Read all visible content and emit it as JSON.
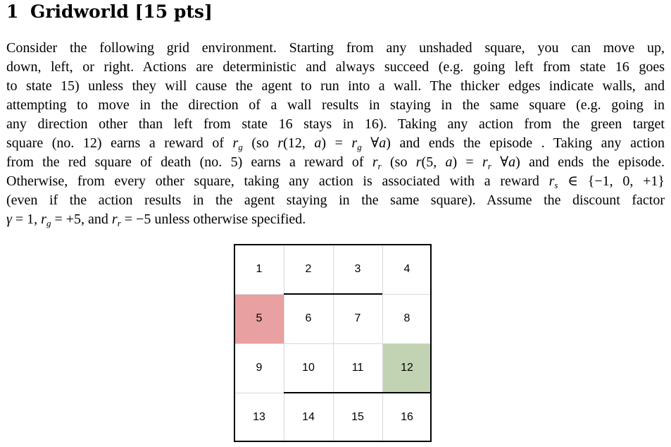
{
  "section": {
    "number": "1",
    "title": "Gridworld [15 pts]"
  },
  "paragraph_lines": [
    [
      "Consider the following grid environment. Starting from any unshaded square, you can move up,"
    ],
    [
      "down, left, or right. Actions are deterministic and always succeed (e.g. going left from state 16 goes"
    ],
    [
      "to state 15) unless they will cause the agent to run into a wall. The thicker edges indicate walls, and"
    ],
    [
      "attempting to move in the direction of a wall results in staying in the same square (e.g. going in"
    ],
    [
      "any direction other than left from state 16 stays in 16). Taking any action from the green target"
    ],
    [
      "square (no. 12) earns a reward of ",
      {
        "v": "r"
      },
      {
        "s": "g"
      },
      " (so ",
      {
        "v": "r"
      },
      "(12, ",
      {
        "v": "a"
      },
      ") = ",
      {
        "v": "r"
      },
      {
        "s": "g"
      },
      " ∀",
      {
        "v": "a"
      },
      ") and ends the episode . Taking any action"
    ],
    [
      "from the red square of death (no. 5) earns a reward of ",
      {
        "v": "r"
      },
      {
        "s": "r"
      },
      " (so ",
      {
        "v": "r"
      },
      "(5, ",
      {
        "v": "a"
      },
      ") = ",
      {
        "v": "r"
      },
      {
        "s": "r"
      },
      " ∀",
      {
        "v": "a"
      },
      ") and ends the episode."
    ],
    [
      "Otherwise, from every other square, taking any action is associated with a reward ",
      {
        "v": "r"
      },
      {
        "s": "s"
      },
      " ∈ {−1, 0, +1}"
    ],
    [
      "(even if the action results in the agent staying in the same square). Assume the discount factor"
    ],
    [
      {
        "v": "γ"
      },
      " = 1, ",
      {
        "v": "r"
      },
      {
        "s": "g"
      },
      " = +5, and ",
      {
        "v": "r"
      },
      {
        "s": "r"
      },
      " = −5 unless otherwise specified."
    ]
  ],
  "grid": {
    "cells": [
      {
        "label": "1",
        "fill": "#ffffff"
      },
      {
        "label": "2",
        "fill": "#ffffff"
      },
      {
        "label": "3",
        "fill": "#ffffff"
      },
      {
        "label": "4",
        "fill": "#ffffff"
      },
      {
        "label": "5",
        "fill": "#e8a0a0"
      },
      {
        "label": "6",
        "fill": "#ffffff"
      },
      {
        "label": "7",
        "fill": "#ffffff"
      },
      {
        "label": "8",
        "fill": "#ffffff"
      },
      {
        "label": "9",
        "fill": "#ffffff"
      },
      {
        "label": "10",
        "fill": "#ffffff"
      },
      {
        "label": "11",
        "fill": "#ffffff"
      },
      {
        "label": "12",
        "fill": "#c2d3b4"
      },
      {
        "label": "13",
        "fill": "#ffffff"
      },
      {
        "label": "14",
        "fill": "#ffffff"
      },
      {
        "label": "15",
        "fill": "#ffffff"
      },
      {
        "label": "16",
        "fill": "#ffffff"
      }
    ]
  }
}
